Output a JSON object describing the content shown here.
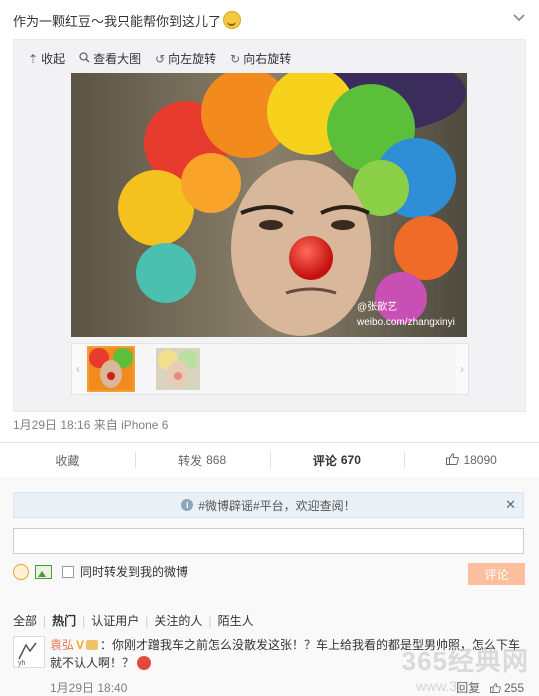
{
  "post": {
    "text": "作为一颗红豆～我只能帮你到这儿了",
    "emoji_icon": "smile-emoji"
  },
  "media_toolbar": {
    "collapse": "收起",
    "view_large": "查看大图",
    "rotate_left": "向左旋转",
    "rotate_right": "向右旋转"
  },
  "photo": {
    "watermark": "@张歆艺",
    "watermark_url": "weibo.com/zhangxinyi"
  },
  "meta": {
    "time": "1月29日 18:16",
    "source": "来自 iPhone 6"
  },
  "actions": {
    "favorite": "收藏",
    "repost_label": "转发",
    "repost_count": "868",
    "comment_label": "评论",
    "comment_count": "670",
    "like_count": "18090"
  },
  "comment_box": {
    "notice": "#微博辟谣#平台，欢迎查阅！",
    "input_value": "",
    "also_repost": "同时转发到我的微博",
    "submit": "评论"
  },
  "filters": [
    "全部",
    "热门",
    "认证用户",
    "关注的人",
    "陌生人"
  ],
  "comment": {
    "user": "袁弘",
    "text": "：你刚才蹭我车之前怎么没散发这张！？车上给我看的都是型男帅照，怎么下车就不认人啊！？",
    "time": "1月29日 18:40",
    "reply": "回复",
    "like_count": "255"
  },
  "site_watermark": {
    "main": "365经典网",
    "sub": "www.36…"
  },
  "colors": {
    "accent_orange": "#eb7350",
    "submit_bg": "#fbbf9d"
  }
}
